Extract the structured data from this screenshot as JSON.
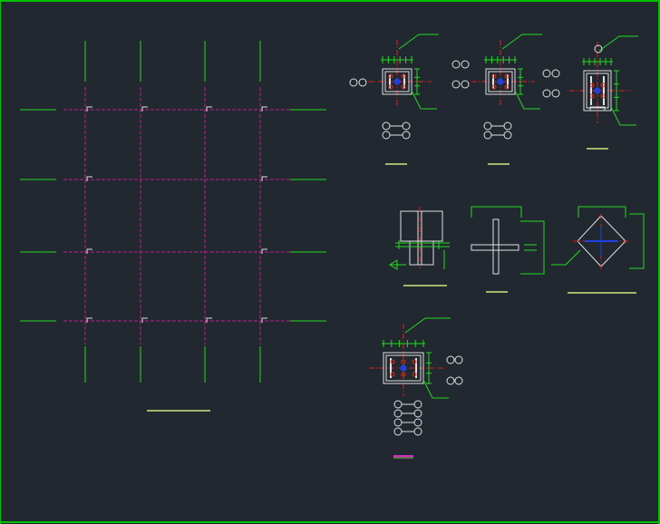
{
  "drawing": {
    "background": "#212830",
    "colors": {
      "frame": "#00c000",
      "gridline": "#22d822",
      "beam": "#c0208a",
      "centerline": "#e02020",
      "column": "#e0e0e0",
      "dimension": "#22d822",
      "bolt": "#e03020",
      "anchor": "#2040e0",
      "title_underline": "#a8b46a",
      "title_underline_alt": "#d030c0"
    },
    "plan": {
      "columns": 4,
      "rows": 4,
      "column_markers": "corner-bracket"
    },
    "details": [
      {
        "kind": "base-plate-plan",
        "bolts": 4,
        "caption": ""
      },
      {
        "kind": "base-plate-plan",
        "bolts": 4,
        "caption": ""
      },
      {
        "kind": "base-plate-plan",
        "bolts": 4,
        "caption": ""
      },
      {
        "kind": "column-elevation",
        "caption": ""
      },
      {
        "kind": "cross-section",
        "caption": ""
      },
      {
        "kind": "diamond-section",
        "caption": ""
      },
      {
        "kind": "base-plate-plan",
        "bolts": 6,
        "caption": ""
      }
    ]
  }
}
